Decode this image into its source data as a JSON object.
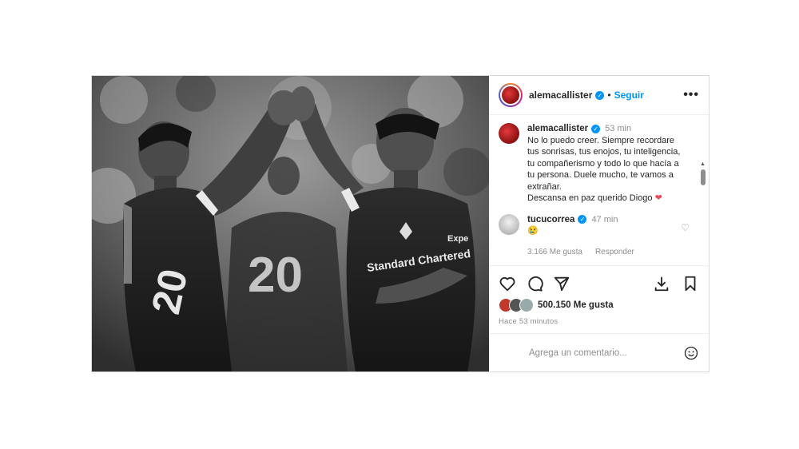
{
  "header": {
    "username": "alemacallister",
    "follow_label": "Seguir",
    "dot": "•",
    "more_label": "•••"
  },
  "caption": {
    "username": "alemacallister",
    "time": "53 min",
    "lines": [
      "No lo puedo creer. Siempre recordare",
      "tus sonrisas, tus enojos, tu inteligencia,",
      "tu compañerismo y todo lo que hacía a",
      "tu persona. Duele mucho, te vamos a",
      "extrañar.",
      "Descansa en paz querido Diogo"
    ],
    "heart": "❤"
  },
  "reply": {
    "username": "tucucorrea",
    "time": "47 min",
    "text": "😢",
    "likes": "3.166 Me gusta",
    "reply_label": "Responder"
  },
  "stats": {
    "likes": "500.150 Me gusta",
    "ago": "Hace 53 minutos"
  },
  "add_comment": {
    "placeholder": "Agrega un comentario..."
  },
  "photo": {
    "jersey_left": "20",
    "jersey_back": "20",
    "sponsor": "Standard Chartered",
    "sponsor_short": "Expe"
  },
  "colors": {
    "accent": "#0095f6",
    "heart": "#ed4956",
    "muted": "#8e8e8e"
  }
}
